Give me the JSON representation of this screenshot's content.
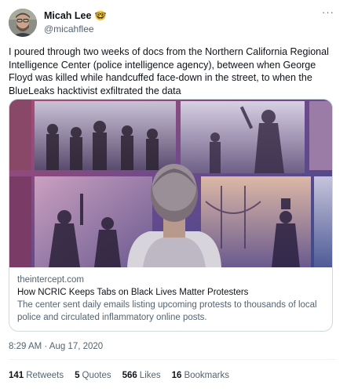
{
  "user": {
    "display_name": "Micah Lee",
    "emoji": "🤓",
    "handle": "@micahflee"
  },
  "tweet": {
    "text": "I poured through two weeks of docs from the Northern California Regional Intelligence Center (police intelligence agency), between when George Floyd was killed while handcuffed face-down in the street, to when the BlueLeaks hacktivist exfiltrated the data",
    "timestamp": "8:29 AM · Aug 17, 2020"
  },
  "card": {
    "domain": "theintercept.com",
    "title": "How NCRIC Keeps Tabs on Black Lives Matter Protesters",
    "description": "The center sent daily emails listing upcoming protests to thousands of local police and circulated inflammatory online posts."
  },
  "stats": {
    "retweets_count": "141",
    "retweets_label": "Retweets",
    "quotes_count": "5",
    "quotes_label": "Quotes",
    "likes_count": "566",
    "likes_label": "Likes",
    "bookmarks_count": "16",
    "bookmarks_label": "Bookmarks"
  },
  "icons": {
    "more": "more-horizontal-icon"
  },
  "colors": {
    "text_primary": "#0f1419",
    "text_secondary": "#536471",
    "border": "#cfd9de"
  }
}
